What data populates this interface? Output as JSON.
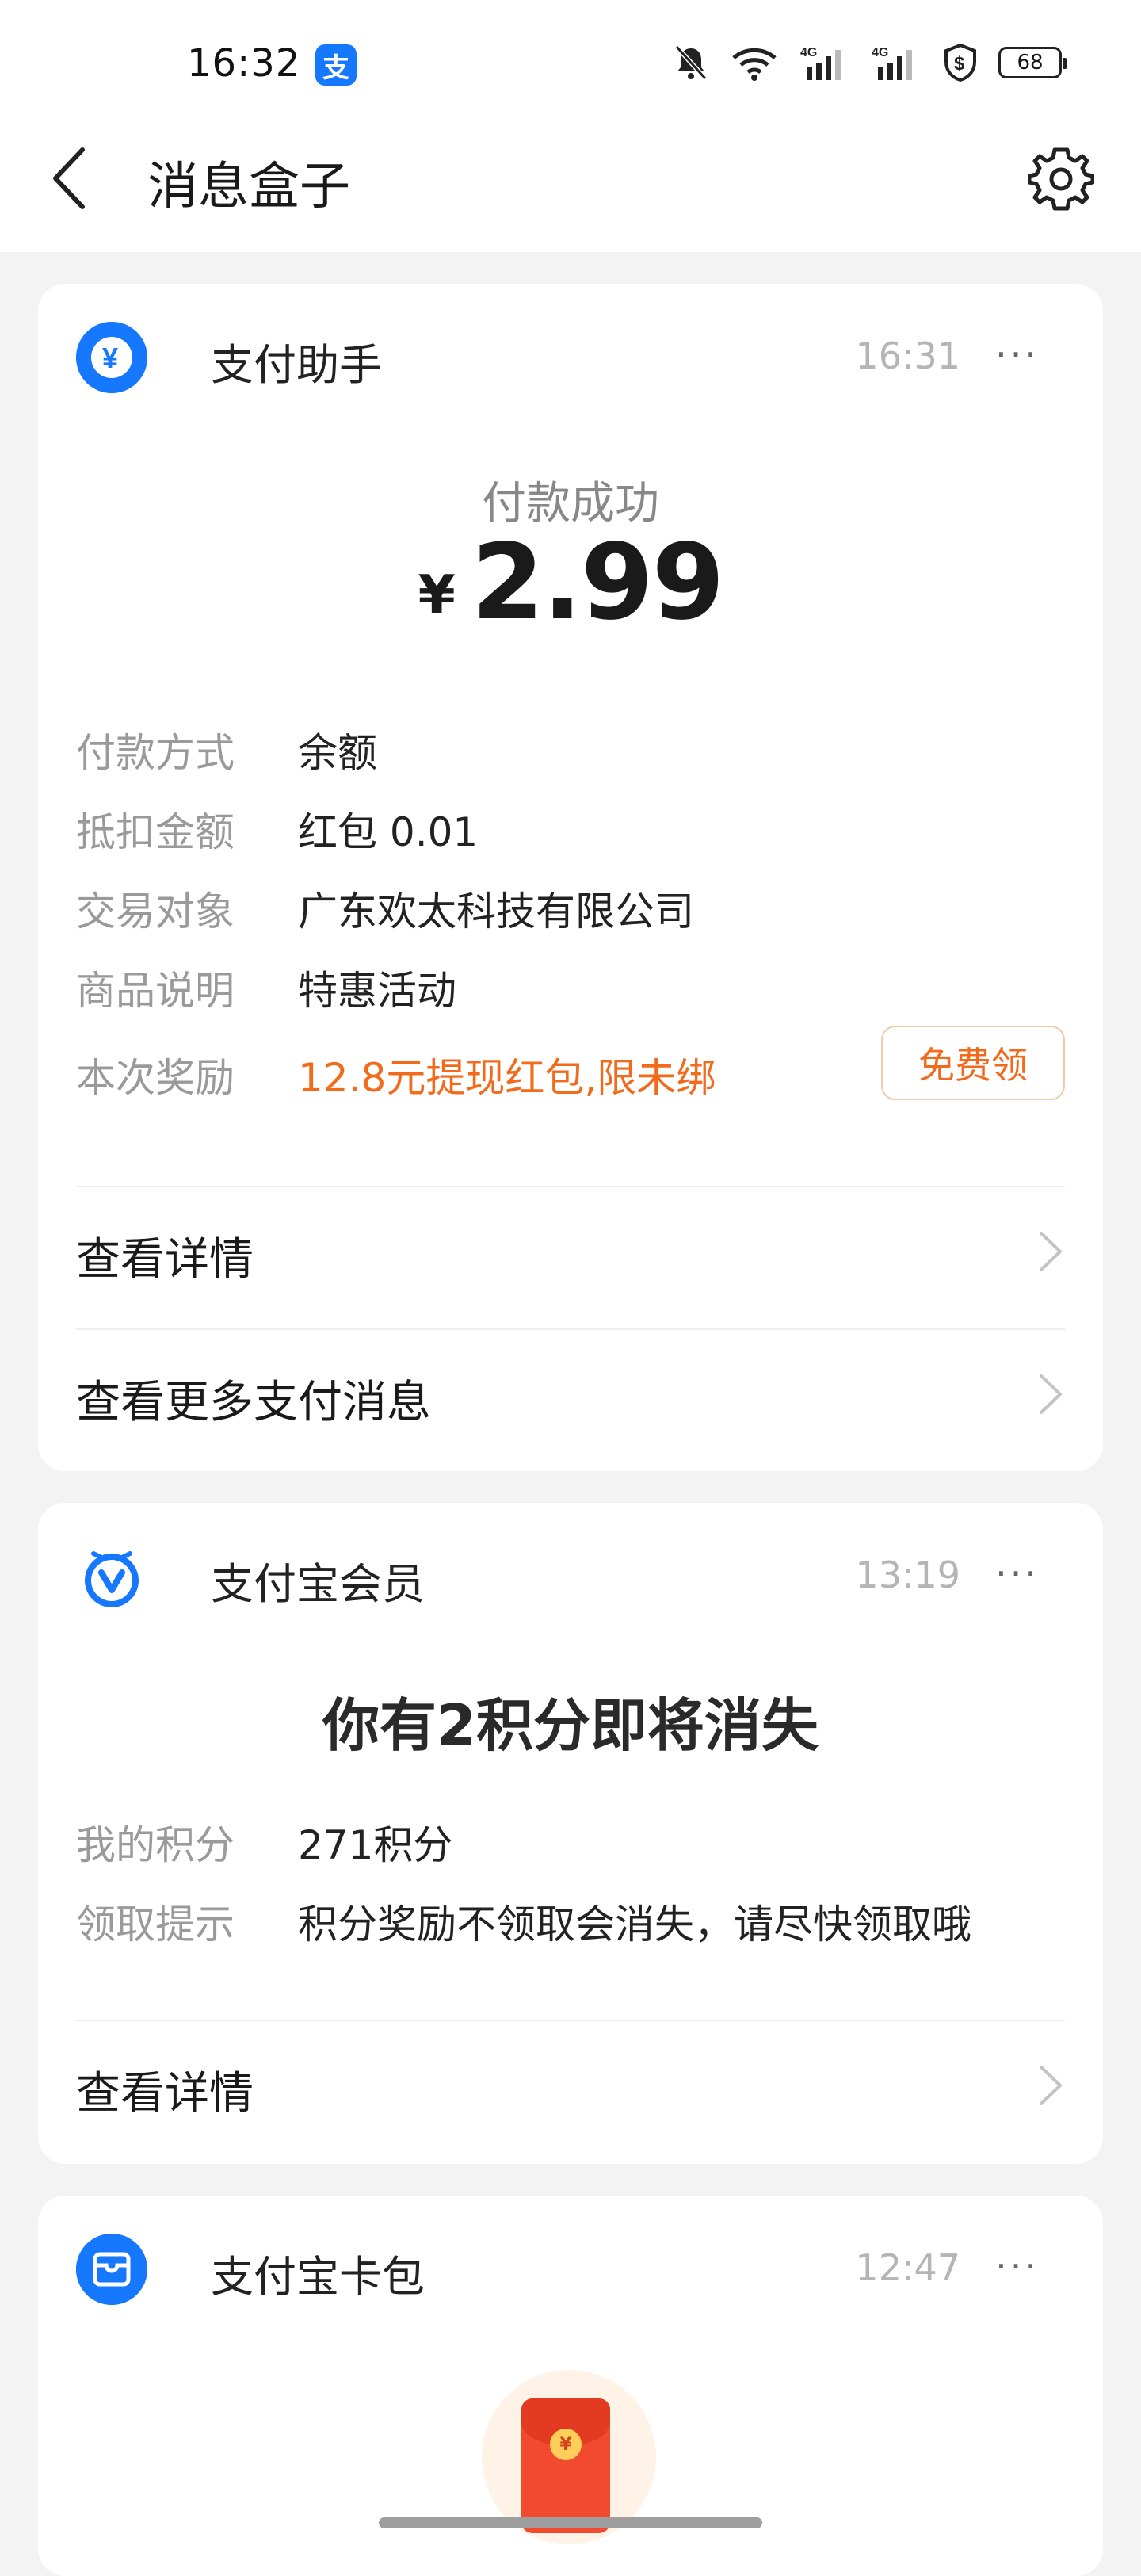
{
  "status_bar": {
    "time": "16:32",
    "alipay_badge": "支",
    "battery": "68"
  },
  "header": {
    "title": "消息盒子",
    "icons": [
      "back-arrow-icon",
      "settings-gear-icon"
    ]
  },
  "colors": {
    "accent_blue": "#1677ff",
    "orange": "#f26b1d",
    "grey_text": "#9a9a9a"
  },
  "cards": [
    {
      "source": "支付助手",
      "time": "16:31",
      "more": "···",
      "status": "付款成功",
      "currency": "¥",
      "amount": "2.99",
      "rows": [
        {
          "key": "付款方式",
          "value": "余额"
        },
        {
          "key": "抵扣金额",
          "value": "红包 0.01"
        },
        {
          "key": "交易对象",
          "value": "广东欢太科技有限公司"
        },
        {
          "key": "商品说明",
          "value": "特惠活动"
        },
        {
          "key": "本次奖励",
          "value": "12.8元提现红包,限未绑",
          "button": "免费领"
        }
      ],
      "links": [
        "查看详情",
        "查看更多支付消息"
      ]
    },
    {
      "source": "支付宝会员",
      "time": "13:19",
      "more": "···",
      "title": "你有2积分即将消失",
      "rows": [
        {
          "key": "我的积分",
          "value": "271积分"
        },
        {
          "key": "领取提示",
          "value": "积分奖励不领取会消失，请尽快领取哦"
        }
      ],
      "links": [
        "查看详情"
      ]
    },
    {
      "source": "支付宝卡包",
      "time": "12:47",
      "more": "···",
      "envelope_coin": "¥"
    }
  ]
}
